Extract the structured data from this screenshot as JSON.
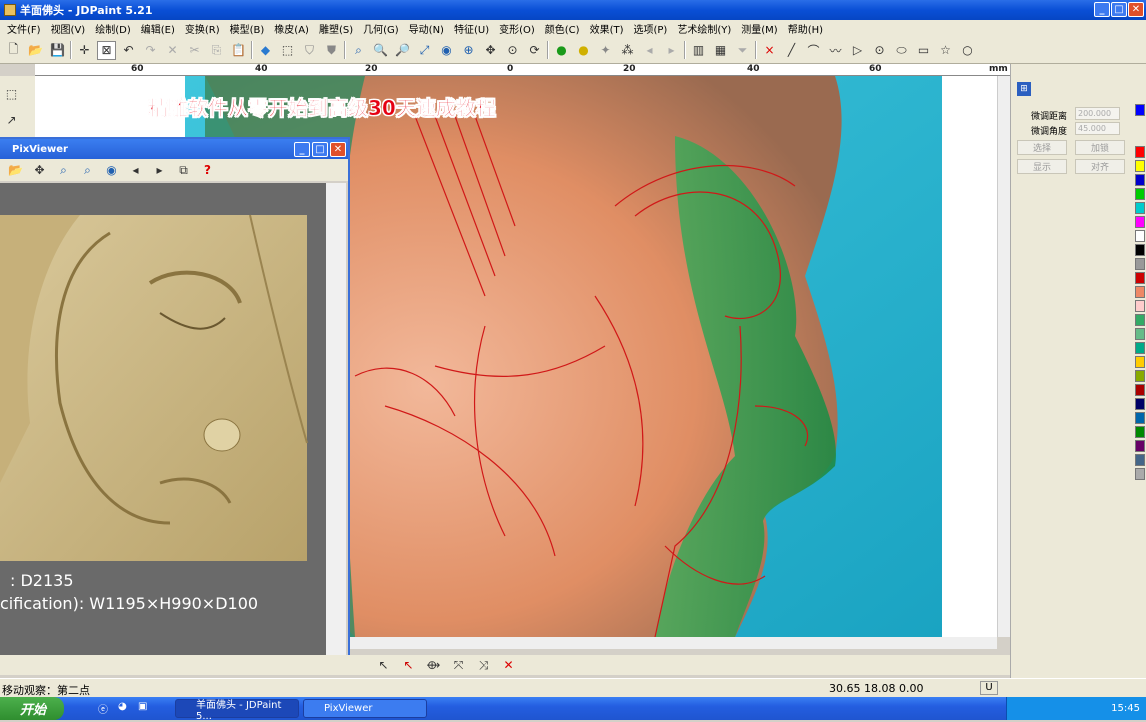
{
  "window": {
    "title": "羊面佛头 - JDPaint 5.21"
  },
  "menu": [
    "文件(F)",
    "视图(V)",
    "绘制(D)",
    "编辑(E)",
    "变换(R)",
    "模型(B)",
    "橡皮(A)",
    "雕塑(S)",
    "几何(G)",
    "导动(N)",
    "特征(U)",
    "变形(O)",
    "颜色(C)",
    "效果(T)",
    "选项(P)",
    "艺术绘制(Y)",
    "测量(M)",
    "帮助(H)"
  ],
  "ruler": {
    "unit": "mm",
    "ticks": [
      "60",
      "40",
      "20",
      "0",
      "20",
      "40",
      "60"
    ]
  },
  "banner": {
    "text": "精雕软件从零开始到高级30天速成教程"
  },
  "pixviewer": {
    "title": "PixViewer",
    "info_id": ": D2135",
    "info_spec": "cification): W1195×H990×D100"
  },
  "right_panel": {
    "fine_dist_label": "微调距离",
    "fine_dist_value": "200.000",
    "fine_angle_label": "微调角度",
    "fine_angle_value": "45.000",
    "btn_select": "选择",
    "btn_lock": "加锁",
    "btn_show": "显示",
    "btn_align": "对齐"
  },
  "status": {
    "message": "移动观察：第二点",
    "coords": "30.65  18.08  0.00",
    "mode": "U"
  },
  "taskbar": {
    "start": "开始",
    "tasks": [
      "羊面佛头 - JDPaint 5...",
      "PixViewer"
    ],
    "clock": "15:45"
  },
  "colors": {
    "title_bar": "#0a4fd6",
    "banner": "#e60012",
    "canvas_bg": "#2fb8d0",
    "taskbar": "#245ee0"
  }
}
